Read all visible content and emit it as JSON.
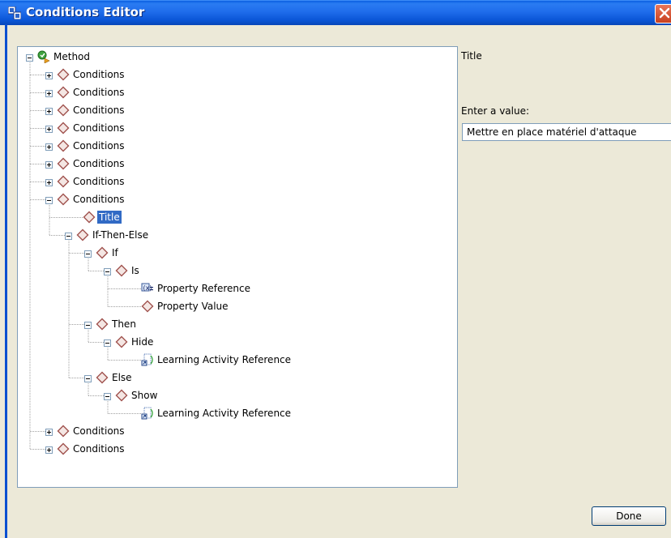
{
  "window": {
    "title": "Conditions Editor"
  },
  "tree": {
    "nodes": [
      {
        "label": "Method",
        "icon": "method-icon",
        "expander": "collapse"
      },
      {
        "label": "Conditions",
        "icon": "diamond-icon",
        "expander": "expand"
      },
      {
        "label": "Conditions",
        "icon": "diamond-icon",
        "expander": "expand"
      },
      {
        "label": "Conditions",
        "icon": "diamond-icon",
        "expander": "expand"
      },
      {
        "label": "Conditions",
        "icon": "diamond-icon",
        "expander": "expand"
      },
      {
        "label": "Conditions",
        "icon": "diamond-icon",
        "expander": "expand"
      },
      {
        "label": "Conditions",
        "icon": "diamond-icon",
        "expander": "expand"
      },
      {
        "label": "Conditions",
        "icon": "diamond-icon",
        "expander": "expand"
      },
      {
        "label": "Conditions",
        "icon": "diamond-icon",
        "expander": "collapse"
      },
      {
        "label": "Title",
        "icon": "diamond-icon",
        "expander": "none",
        "selected": true
      },
      {
        "label": "If-Then-Else",
        "icon": "diamond-icon",
        "expander": "collapse"
      },
      {
        "label": "If",
        "icon": "diamond-icon",
        "expander": "collapse"
      },
      {
        "label": "Is",
        "icon": "diamond-icon",
        "expander": "collapse"
      },
      {
        "label": "Property Reference",
        "icon": "property-reference-icon",
        "expander": "none"
      },
      {
        "label": "Property Value",
        "icon": "diamond-icon",
        "expander": "none"
      },
      {
        "label": "Then",
        "icon": "diamond-icon",
        "expander": "collapse"
      },
      {
        "label": "Hide",
        "icon": "diamond-icon",
        "expander": "collapse"
      },
      {
        "label": "Learning Activity Reference",
        "icon": "learning-activity-reference-icon",
        "expander": "none"
      },
      {
        "label": "Else",
        "icon": "diamond-icon",
        "expander": "collapse"
      },
      {
        "label": "Show",
        "icon": "diamond-icon",
        "expander": "collapse"
      },
      {
        "label": "Learning Activity Reference",
        "icon": "learning-activity-reference-icon",
        "expander": "none"
      },
      {
        "label": "Conditions",
        "icon": "diamond-icon",
        "expander": "expand"
      },
      {
        "label": "Conditions",
        "icon": "diamond-icon",
        "expander": "expand"
      }
    ]
  },
  "editor": {
    "property_label": "Title",
    "prompt": "Enter a value:",
    "value": "Mettre en place matériel d'attaque"
  },
  "buttons": {
    "done": "Done"
  },
  "colors": {
    "titlebar": "#0A5FE0",
    "selection": "#316AC5",
    "diamond": "#A0524E",
    "close_button": "#D84A2A"
  }
}
